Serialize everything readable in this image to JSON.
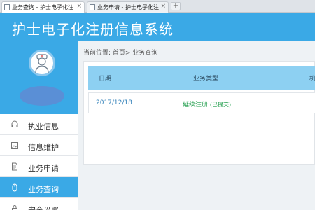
{
  "browser": {
    "tabs": [
      {
        "label": "业务查询 - 护士电子化注",
        "active": true
      },
      {
        "label": "业务申请 - 护士电子化注",
        "active": false
      }
    ],
    "close_glyph": "×",
    "new_tab_glyph": "+"
  },
  "header": {
    "title": "护士电子化注册信息系统"
  },
  "sidebar": {
    "items": [
      {
        "label": "执业信息",
        "icon": "headset-icon"
      },
      {
        "label": "信息维护",
        "icon": "image-icon"
      },
      {
        "label": "业务申请",
        "icon": "document-icon"
      },
      {
        "label": "业务查询",
        "icon": "mouse-icon",
        "active": true
      },
      {
        "label": "安全设置",
        "icon": "lock-icon"
      }
    ]
  },
  "main": {
    "breadcrumb": "当前位置: 首页> 业务查询",
    "table": {
      "columns": [
        "日期",
        "业务类型",
        "机"
      ],
      "rows": [
        {
          "date": "2017/12/18",
          "type": "延续注册",
          "status": "(已提交)"
        }
      ]
    }
  },
  "colors": {
    "accent": "#3aa9e6",
    "table_header": "#8dd0f2",
    "date_text": "#2f7fb8",
    "status_text": "#1e9c4a"
  }
}
